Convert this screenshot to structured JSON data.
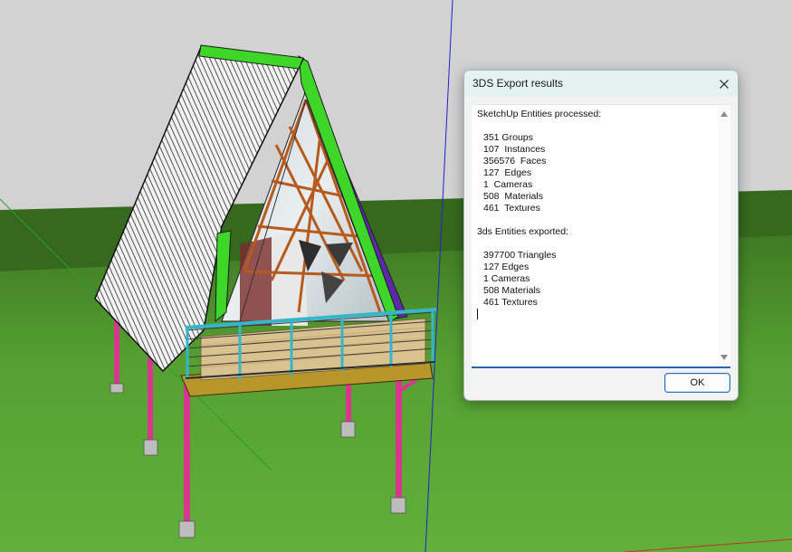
{
  "dialog": {
    "title": "3DS Export results",
    "ok_label": "OK",
    "processed_heading": "SketchUp Entities processed:",
    "processed_items": [
      "351 Groups",
      "107  Instances",
      "356576  Faces",
      "127  Edges",
      "1  Cameras",
      "508  Materials",
      "461  Textures"
    ],
    "exported_heading": "3ds Entities exported:",
    "exported_items": [
      "397700 Triangles",
      "127 Edges",
      "1 Cameras",
      "508 Materials",
      "461 Textures"
    ]
  },
  "icons": {
    "close": "close-icon",
    "scroll_up": "scroll-up-arrow-icon",
    "scroll_down": "scroll-down-arrow-icon"
  },
  "colors": {
    "title_bar": "#e4f2f1",
    "accent": "#2a64b2",
    "ground": "#4f8a2c",
    "sky": "#d2d2d2"
  }
}
